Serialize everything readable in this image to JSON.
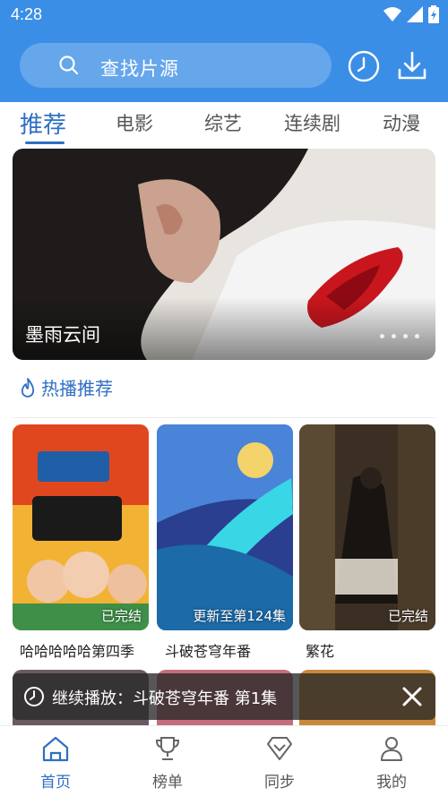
{
  "status": {
    "time": "4:28"
  },
  "search": {
    "placeholder": "查找片源"
  },
  "tabs": [
    {
      "label": "推荐",
      "active": true
    },
    {
      "label": "电影"
    },
    {
      "label": "综艺"
    },
    {
      "label": "连续剧"
    },
    {
      "label": "动漫"
    }
  ],
  "banner": {
    "title": "墨雨云间"
  },
  "section": {
    "title": "热播推荐"
  },
  "cards": [
    {
      "title": "哈哈哈哈哈第四季",
      "badge": "已完结"
    },
    {
      "title": "斗破苍穹年番",
      "badge": "更新至第124集"
    },
    {
      "title": "繁花",
      "badge": "已完结"
    }
  ],
  "resume": {
    "text": "继续播放：斗破苍穹年番 第1集"
  },
  "bottom_nav": [
    {
      "label": "首页",
      "active": true
    },
    {
      "label": "榜单"
    },
    {
      "label": "同步"
    },
    {
      "label": "我的"
    }
  ],
  "colors": {
    "primary": "#3b8ee6",
    "accent": "#2e6fc4"
  }
}
